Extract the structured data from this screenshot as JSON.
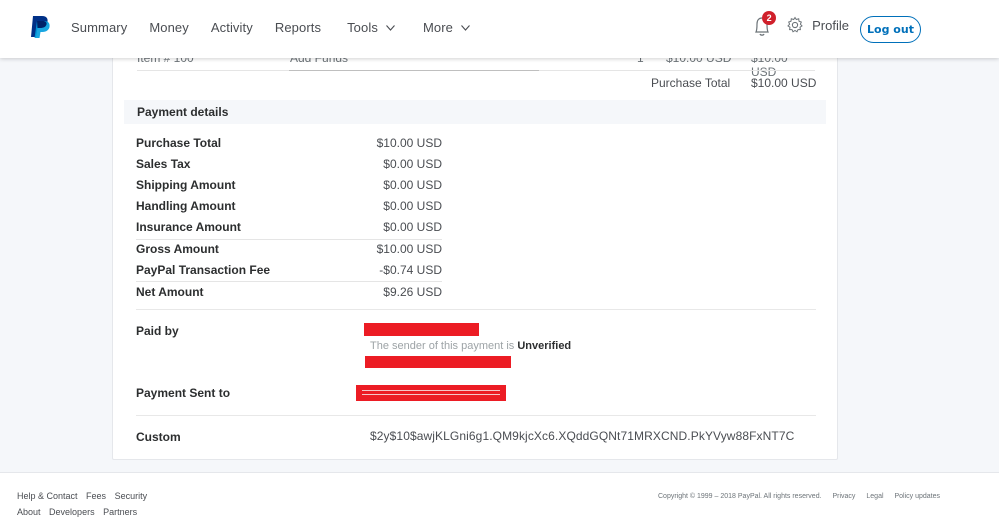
{
  "header": {
    "nav": [
      {
        "label": "Summary"
      },
      {
        "label": "Money"
      },
      {
        "label": "Activity"
      },
      {
        "label": "Reports"
      },
      {
        "label": "Tools",
        "has_dropdown": true
      },
      {
        "label": "More",
        "has_dropdown": true
      }
    ],
    "notification_count": "2",
    "profile_label": "Profile",
    "logout_label": "Log out",
    "colors": {
      "brand_dark": "#003087",
      "brand_light": "#009cde",
      "accent": "#0070ba",
      "badge": "#d0202b"
    }
  },
  "items": {
    "row": {
      "item_number": "Item # 100",
      "description": "Add Funds",
      "quantity": "1",
      "price": "$10.00 USD",
      "amount": "$10.00 USD"
    },
    "purchase_total_label": "Purchase Total",
    "purchase_total_value": "$10.00 USD"
  },
  "payment_details": {
    "title": "Payment details",
    "rows": [
      {
        "label": "Purchase Total",
        "value": "$10.00 USD"
      },
      {
        "label": "Sales Tax",
        "value": "$0.00 USD"
      },
      {
        "label": "Shipping Amount",
        "value": "$0.00 USD"
      },
      {
        "label": "Handling Amount",
        "value": "$0.00 USD"
      },
      {
        "label": "Insurance Amount",
        "value": "$0.00 USD"
      },
      {
        "label": "Gross Amount",
        "value": "$10.00 USD"
      },
      {
        "label": "PayPal Transaction Fee",
        "value": "-$0.74 USD"
      },
      {
        "label": "Net Amount",
        "value": "$9.26 USD"
      }
    ]
  },
  "paid_by": {
    "label": "Paid by",
    "note_prefix": "The sender of this payment is",
    "status": "Unverified"
  },
  "payment_sent_to": {
    "label": "Payment Sent to"
  },
  "custom": {
    "label": "Custom",
    "value": "$2y$10$awjKLGni6g1.QM9kjcXc6.XQddGQNt71MRXCND.PkYVyw88FxNT7C"
  },
  "footer": {
    "links_row1": [
      "Help & Contact",
      "Fees",
      "Security"
    ],
    "links_row2": [
      "About",
      "Developers",
      "Partners"
    ],
    "copyright": "Copyright © 1999 – 2018 PayPal. All rights reserved.",
    "legal_links": [
      "Privacy",
      "Legal",
      "Policy updates"
    ]
  }
}
